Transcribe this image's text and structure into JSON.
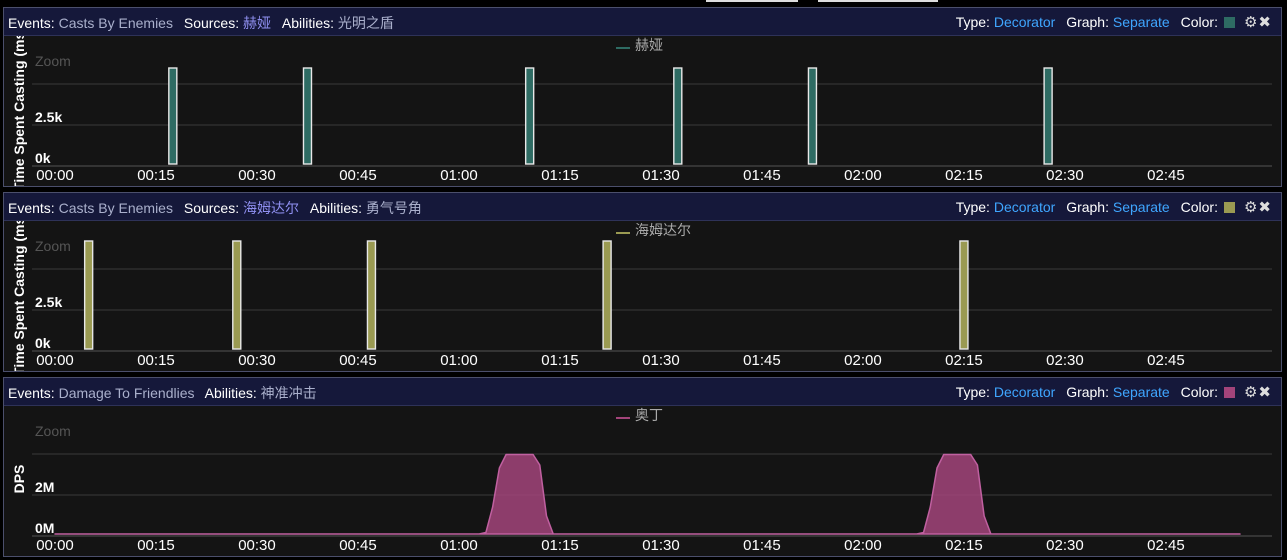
{
  "panels": [
    {
      "header": {
        "events_label": "Events:",
        "events_value": "Casts By Enemies",
        "sources_label": "Sources:",
        "sources_value": "赫娅",
        "abilities_label": "Abilities:",
        "abilities_value": "光明之盾",
        "type_label": "Type:",
        "type_value": "Decorator",
        "graph_label": "Graph:",
        "graph_value": "Separate",
        "color_label": "Color:",
        "settings_icon": "⚙",
        "close_icon": "✖"
      },
      "color": "#2e6b63"
    },
    {
      "header": {
        "events_label": "Events:",
        "events_value": "Casts By Enemies",
        "sources_label": "Sources:",
        "sources_value": "海姆达尔",
        "abilities_label": "Abilities:",
        "abilities_value": "勇气号角",
        "type_label": "Type:",
        "type_value": "Decorator",
        "graph_label": "Graph:",
        "graph_value": "Separate",
        "color_label": "Color:",
        "settings_icon": "⚙",
        "close_icon": "✖"
      },
      "color": "#9a9a52"
    },
    {
      "header": {
        "events_label": "Events:",
        "events_value": "Damage To Friendlies",
        "abilities_label": "Abilities:",
        "abilities_value": "神准冲击",
        "type_label": "Type:",
        "type_value": "Decorator",
        "graph_label": "Graph:",
        "graph_value": "Separate",
        "color_label": "Color:",
        "settings_icon": "⚙",
        "close_icon": "✖"
      },
      "color": "#a2447a"
    }
  ],
  "chart_data": [
    {
      "type": "bar",
      "ylabel": "Time Spent Casting (ms)",
      "zoom_label": "Zoom",
      "x_ticks": [
        "00:00",
        "00:15",
        "00:30",
        "00:45",
        "01:00",
        "01:15",
        "01:30",
        "01:45",
        "02:00",
        "02:15",
        "02:30",
        "02:45"
      ],
      "xlim": [
        0,
        176
      ],
      "y_ticks": [
        "0k",
        "2.5k"
      ],
      "ylim": [
        0,
        5000
      ],
      "series": [
        {
          "name": "赫娅",
          "color": "#2e6b63",
          "x": [
            17.5,
            37.5,
            70.5,
            92.5,
            112.5,
            147.5
          ],
          "values": [
            4000,
            4000,
            4000,
            4000,
            4000,
            4000
          ]
        }
      ]
    },
    {
      "type": "bar",
      "ylabel": "Time Spent Casting (ms)",
      "zoom_label": "Zoom",
      "x_ticks": [
        "00:00",
        "00:15",
        "00:30",
        "00:45",
        "01:00",
        "01:15",
        "01:30",
        "01:45",
        "02:00",
        "02:15",
        "02:30",
        "02:45"
      ],
      "xlim": [
        0,
        176
      ],
      "y_ticks": [
        "0k",
        "2.5k"
      ],
      "ylim": [
        0,
        5000
      ],
      "series": [
        {
          "name": "海姆达尔",
          "color": "#9a9a52",
          "x": [
            5,
            27,
            47,
            82,
            135
          ],
          "values": [
            4500,
            4500,
            4500,
            4500,
            4500
          ]
        }
      ]
    },
    {
      "type": "area",
      "ylabel": "DPS",
      "zoom_label": "Zoom",
      "x_ticks": [
        "00:00",
        "00:15",
        "00:30",
        "00:45",
        "01:00",
        "01:15",
        "01:30",
        "01:45",
        "02:00",
        "02:15",
        "02:30",
        "02:45"
      ],
      "xlim": [
        0,
        176
      ],
      "y_ticks": [
        "0M",
        "2M"
      ],
      "ylim": [
        0,
        4000000
      ],
      "series": [
        {
          "name": "奥丁",
          "color": "#a2447a",
          "x": [
            0,
            63,
            64,
            65,
            66,
            67,
            68,
            69,
            70,
            71,
            72,
            73,
            74,
            128,
            129,
            130,
            131,
            132,
            133,
            134,
            135,
            136,
            137,
            138,
            139,
            176
          ],
          "values": [
            0,
            0,
            50000,
            900000,
            2200000,
            2650000,
            2650000,
            2650000,
            2650000,
            2650000,
            2300000,
            600000,
            0,
            0,
            50000,
            900000,
            2200000,
            2650000,
            2650000,
            2650000,
            2650000,
            2650000,
            2300000,
            600000,
            0,
            0
          ]
        }
      ]
    }
  ]
}
